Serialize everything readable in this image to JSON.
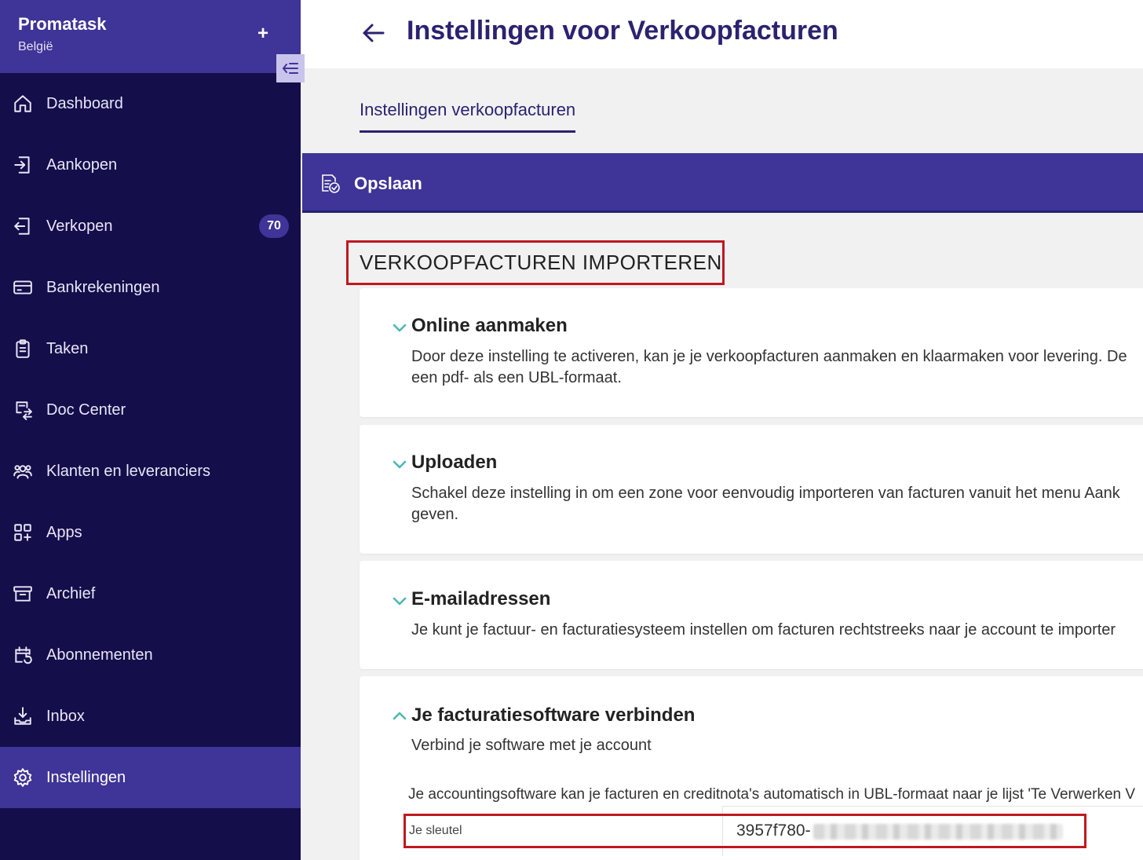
{
  "sidebar": {
    "brand_name": "Promatask",
    "brand_country": "België",
    "items": [
      {
        "label": "Dashboard",
        "icon": "home-icon"
      },
      {
        "label": "Aankopen",
        "icon": "sign-in-icon"
      },
      {
        "label": "Verkopen",
        "icon": "sign-out-icon",
        "badge": "70"
      },
      {
        "label": "Bankrekeningen",
        "icon": "credit-card-icon"
      },
      {
        "label": "Taken",
        "icon": "clipboard-icon"
      },
      {
        "label": "Doc Center",
        "icon": "document-exchange-icon"
      },
      {
        "label": "Klanten en leveranciers",
        "icon": "users-icon"
      },
      {
        "label": "Apps",
        "icon": "apps-grid-icon"
      },
      {
        "label": "Archief",
        "icon": "archive-box-icon"
      },
      {
        "label": "Abonnementen",
        "icon": "calendar-refresh-icon"
      },
      {
        "label": "Inbox",
        "icon": "download-tray-icon"
      },
      {
        "label": "Instellingen",
        "icon": "gear-icon",
        "active": true
      }
    ]
  },
  "header": {
    "title": "Instellingen voor Verkoopfacturen"
  },
  "tabs": [
    {
      "label": "Instellingen verkoopfacturen",
      "active": true
    }
  ],
  "toolbar": {
    "save_label": "Opslaan"
  },
  "section": {
    "heading": "VERKOOPFACTUREN IMPORTEREN"
  },
  "cards": [
    {
      "title": "Online aanmaken",
      "expanded": false,
      "desc_line1": "Door deze instelling te activeren, kan je je verkoopfacturen aanmaken en klaarmaken voor levering. De",
      "desc_line2": "een pdf- als een UBL-formaat."
    },
    {
      "title": "Uploaden",
      "expanded": false,
      "desc_line1": "Schakel deze instelling in om een zone voor eenvoudig importeren van facturen vanuit het menu Aank",
      "desc_line2": "geven."
    },
    {
      "title": "E-mailadressen",
      "expanded": false,
      "desc_line1": "Je kunt je factuur- en facturatiesysteem instellen om facturen rechtstreeks naar je account te importer"
    },
    {
      "title": "Je facturatiesoftware verbinden",
      "expanded": true,
      "desc_line1": "Verbind je software met je account",
      "info": "Je accountingsoftware kan je facturen en creditnota's automatisch in UBL-formaat naar je lijst 'Te Verwerken V",
      "key_label": "Je sleutel",
      "key_value": "3957f780-"
    }
  ],
  "colors": {
    "sidebar_bg": "#140e4b",
    "accent": "#3f3497",
    "title": "#2b2270",
    "chevron": "#4fb8b2",
    "highlight": "#c0181f"
  }
}
